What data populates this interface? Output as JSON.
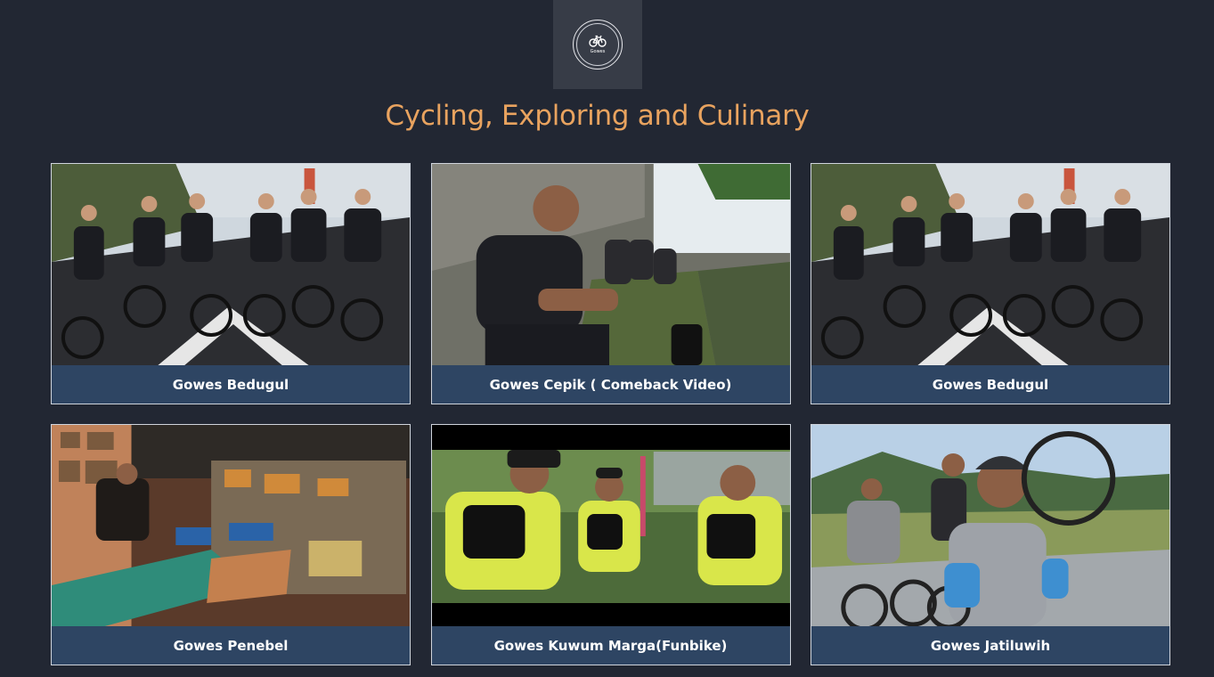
{
  "logo": {
    "text": "Gowes",
    "icon": "bicycle-icon"
  },
  "title": "Cycling, Exploring and Culinary",
  "cards": [
    {
      "caption": "Gowes Bedugul",
      "scene": "group-road"
    },
    {
      "caption": "Gowes Cepik ( Comeback Video)",
      "scene": "sitting-wall"
    },
    {
      "caption": "Gowes Bedugul",
      "scene": "group-road"
    },
    {
      "caption": "Gowes Penebel",
      "scene": "shop"
    },
    {
      "caption": "Gowes Kuwum Marga(Funbike)",
      "scene": "jersey-sitting"
    },
    {
      "caption": "Gowes Jatiluwih",
      "scene": "wheelie"
    }
  ],
  "colors": {
    "background": "#222733",
    "logo_box": "#373c47",
    "title": "#e9a35f",
    "caption_bar": "#2e4563"
  }
}
